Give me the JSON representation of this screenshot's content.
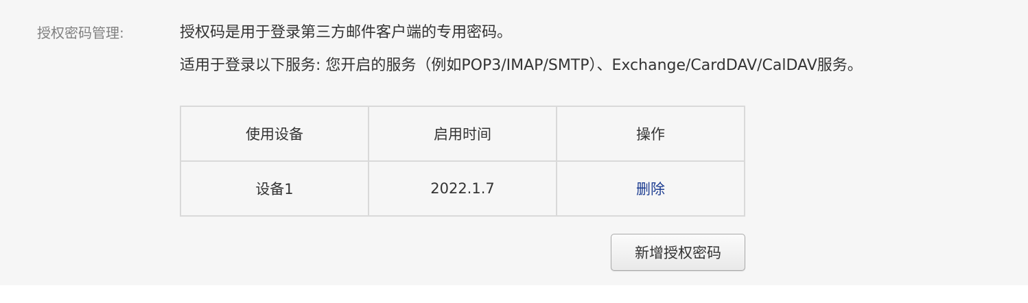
{
  "section": {
    "label": "授权密码管理:",
    "description_line1": "授权码是用于登录第三方邮件客户端的专用密码。",
    "description_line2": "适用于登录以下服务: 您开启的服务（例如POP3/IMAP/SMTP）、Exchange/CardDAV/CalDAV服务。"
  },
  "table": {
    "headers": [
      "使用设备",
      "启用时间",
      "操作"
    ],
    "rows": [
      {
        "device": "设备1",
        "enabled_time": "2022.1.7",
        "action_label": "删除"
      }
    ]
  },
  "add_button_label": "新增授权密码",
  "colors": {
    "panel_background": "#f6f6f6",
    "label_gray": "#808080",
    "link_blue": "#1d3d91",
    "border": "#d9d9d9"
  }
}
